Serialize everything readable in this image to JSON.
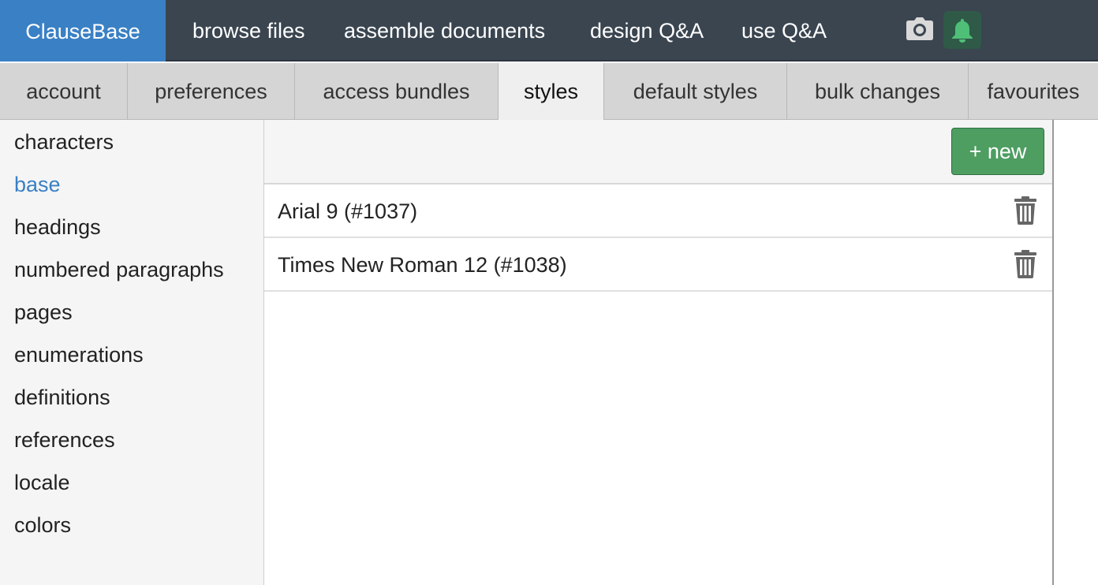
{
  "app": {
    "brand": "ClauseBase"
  },
  "nav": {
    "links": [
      "browse files",
      "assemble documents",
      "design Q&A",
      "use Q&A"
    ],
    "icons": [
      "camera-icon",
      "bell-icon"
    ]
  },
  "tabs": {
    "items": [
      "account",
      "preferences",
      "access bundles",
      "styles",
      "default styles",
      "bulk changes",
      "favourites"
    ],
    "active": "styles"
  },
  "sidebar": {
    "items": [
      "characters",
      "base",
      "headings",
      "numbered paragraphs",
      "pages",
      "enumerations",
      "definitions",
      "references",
      "locale",
      "colors"
    ],
    "active": "base"
  },
  "main": {
    "new_button": "+ new",
    "styles": [
      {
        "label": "Arial 9 (#1037)",
        "action_icon": "trash-icon"
      },
      {
        "label": "Times New Roman 12 (#1038)",
        "action_icon": "trash-icon"
      }
    ]
  },
  "colors": {
    "brand_bg": "#3a80c4",
    "topbar_bg": "#3a4550",
    "notify_bg": "#2f5a48",
    "notify_icon": "#4fbf78",
    "new_button_bg": "#4e9e62",
    "active_link": "#3a80c4"
  }
}
